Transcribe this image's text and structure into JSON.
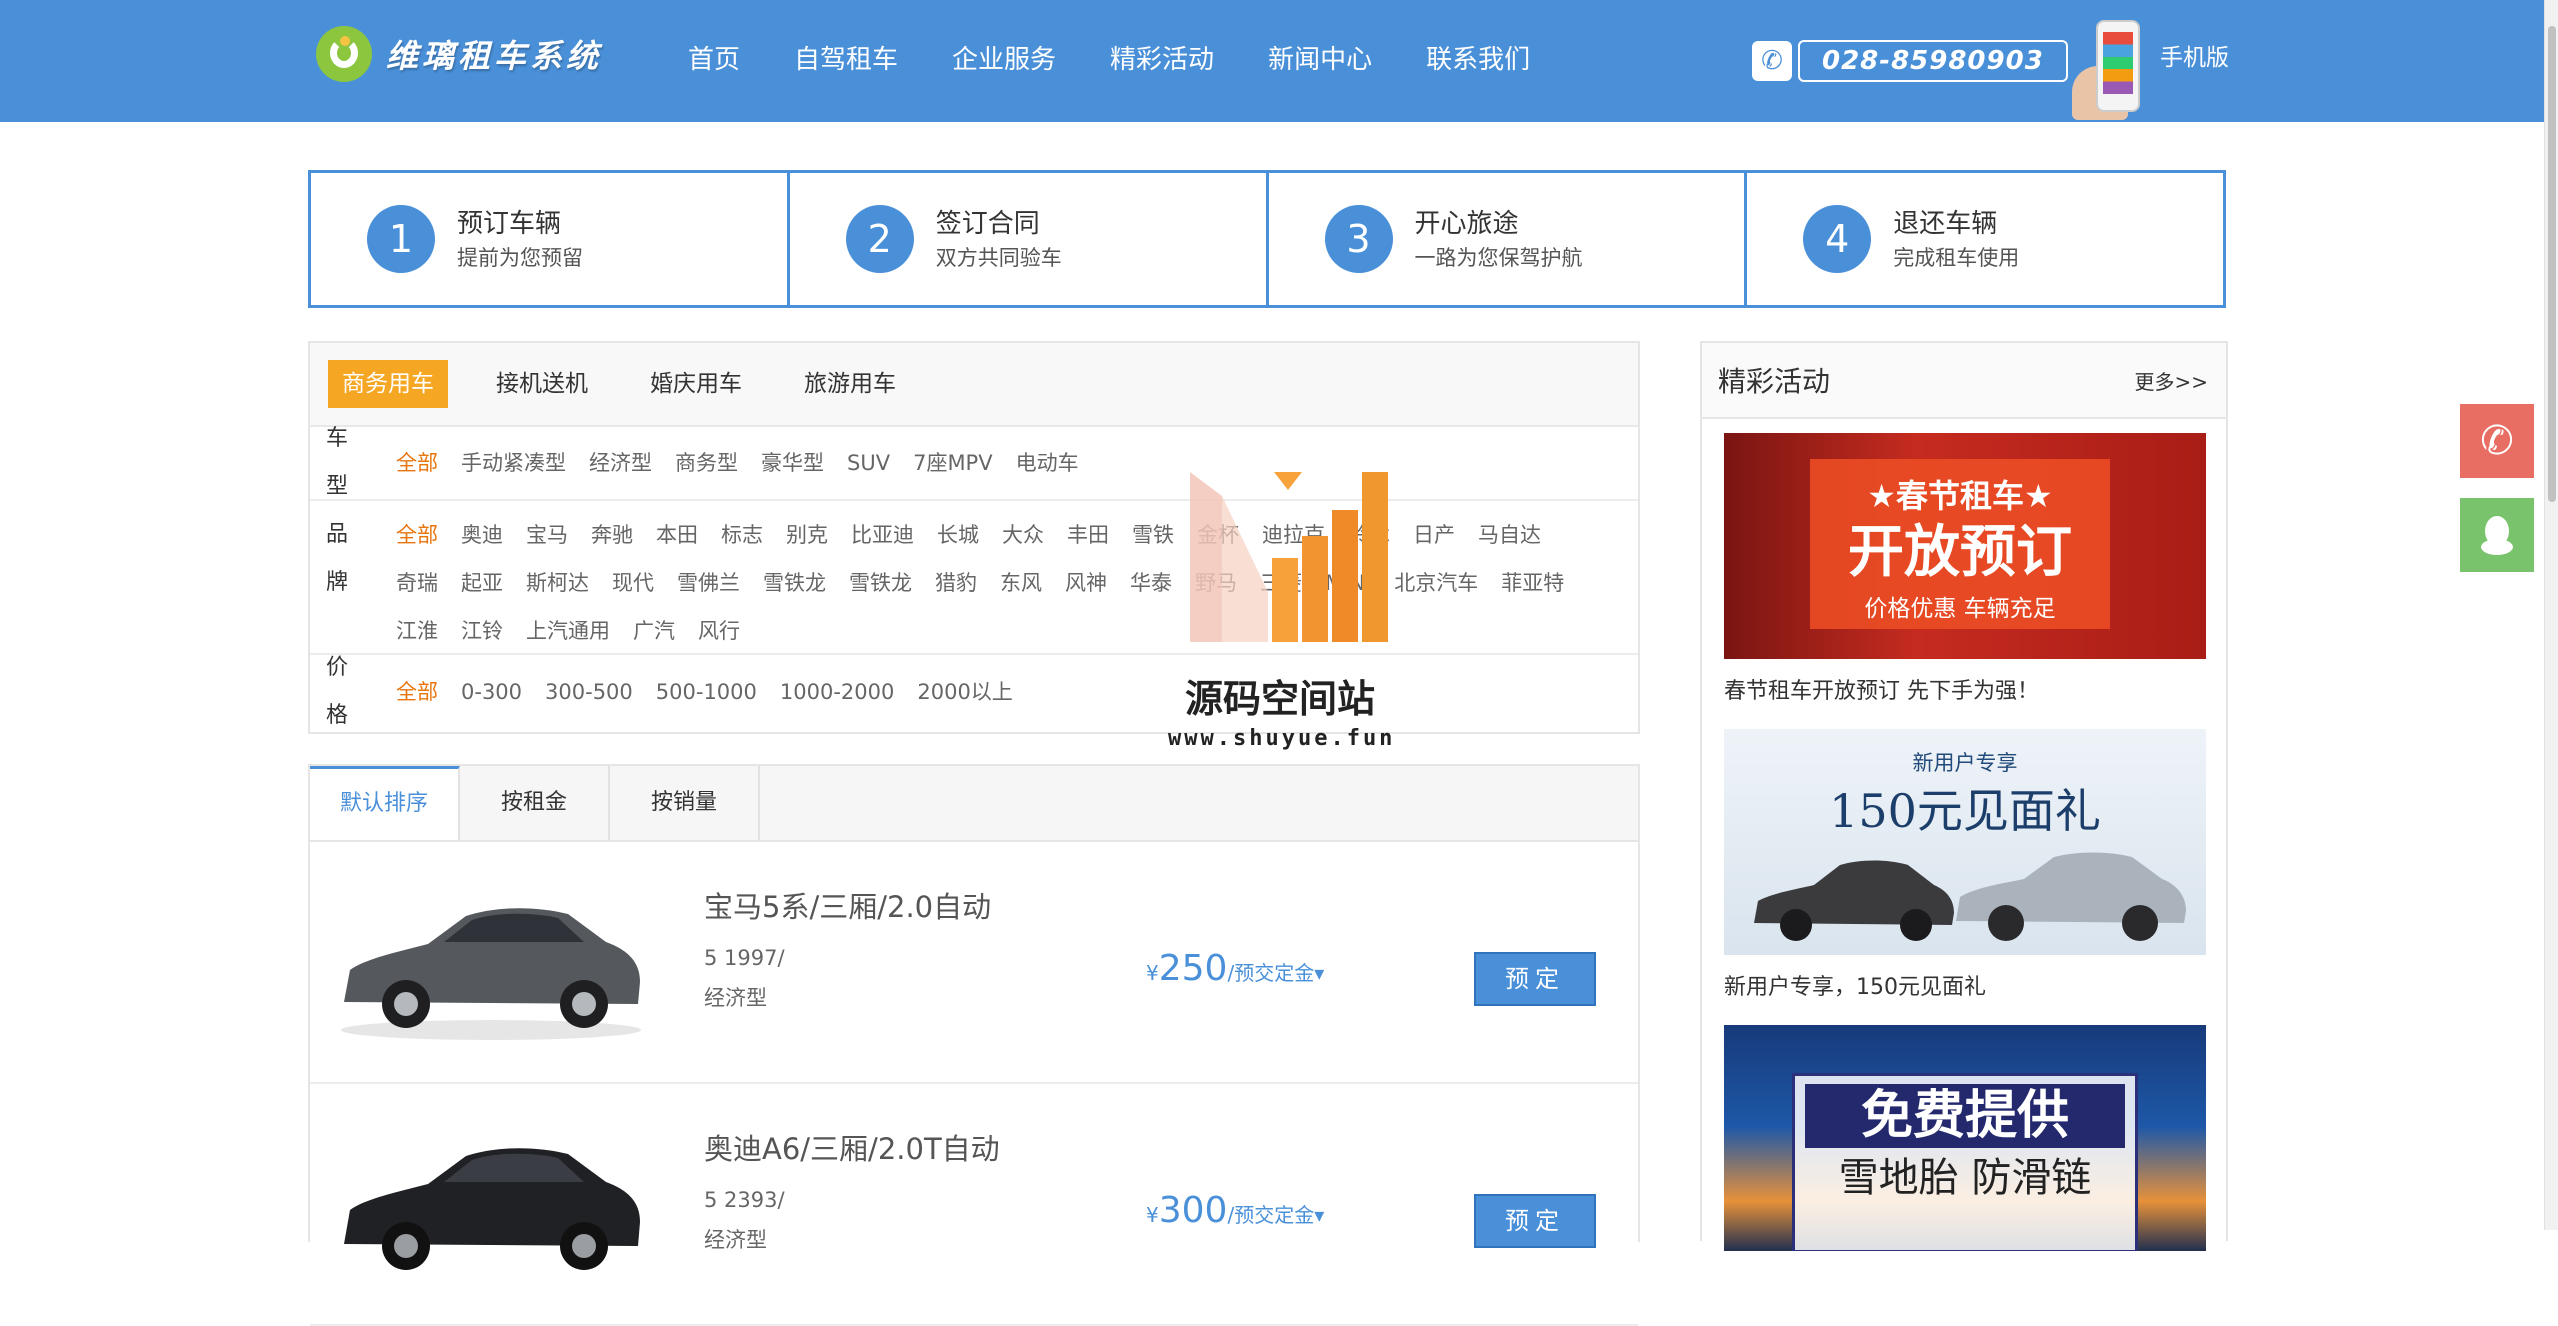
{
  "header": {
    "logo_text": "维璃租车系统",
    "nav": [
      "首页",
      "自驾租车",
      "企业服务",
      "精彩活动",
      "新闻中心",
      "联系我们"
    ],
    "phone": "028-85980903",
    "mobile_label": "手机版"
  },
  "steps": [
    {
      "num": "1",
      "title": "预订车辆",
      "sub": "提前为您预留"
    },
    {
      "num": "2",
      "title": "签订合同",
      "sub": "双方共同验车"
    },
    {
      "num": "3",
      "title": "开心旅途",
      "sub": "一路为您保驾护航"
    },
    {
      "num": "4",
      "title": "退还车辆",
      "sub": "完成租车使用"
    }
  ],
  "filter": {
    "tabs": [
      "商务用车",
      "接机送机",
      "婚庆用车",
      "旅游用车"
    ],
    "active_tab": "商务用车",
    "type": {
      "label": "车 型",
      "options": [
        "全部",
        "手动紧凑型",
        "经济型",
        "商务型",
        "豪华型",
        "SUV",
        "7座MPV",
        "电动车"
      ]
    },
    "brand": {
      "label": "品 牌",
      "options": [
        "全部",
        "奥迪",
        "宝马",
        "奔驰",
        "本田",
        "标志",
        "别克",
        "比亚迪",
        "长城",
        "大众",
        "丰田",
        "雪铁",
        "金杯",
        "迪拉克",
        "铃木",
        "日产",
        "马自达",
        "奇瑞",
        "起亚",
        "斯柯达",
        "现代",
        "雪佛兰",
        "雪铁龙",
        "雪铁龙",
        "猎豹",
        "东风",
        "风神",
        "华泰",
        "野马",
        "三菱",
        "MINI",
        "北京汽车",
        "菲亚特",
        "江淮",
        "江铃",
        "上汽通用",
        "广汽",
        "风行"
      ]
    },
    "price": {
      "label": "价 格",
      "options": [
        "全部",
        "0-300",
        "300-500",
        "500-1000",
        "1000-2000",
        "2000以上"
      ]
    }
  },
  "watermark": {
    "title": "源码空间站",
    "url": "www.shuyue.fun"
  },
  "sort": [
    "默认排序",
    "按租金",
    "按销量"
  ],
  "cars": [
    {
      "name": "宝马5系/三厢/2.0自动",
      "spec1": "5 1997/",
      "spec2": "经济型",
      "currency": "¥",
      "price": "250",
      "unit": "/预交定金▾",
      "button": "预定",
      "color": "#55585d"
    },
    {
      "name": "奥迪A6/三厢/2.0T自动",
      "spec1": "5 2393/",
      "spec2": "经济型",
      "currency": "¥",
      "price": "300",
      "unit": "/预交定金▾",
      "button": "预定",
      "color": "#202124"
    }
  ],
  "side": {
    "title": "精彩活动",
    "more": "更多>>",
    "promos": [
      {
        "caption": "春节租车开放预订 先下手为强！",
        "l1": "★春节租车★",
        "l2": "开放预订",
        "l3": "价格优惠 车辆充足"
      },
      {
        "caption": "新用户专享，150元见面礼",
        "l1": "新用户专享",
        "l2": "150元见面礼"
      },
      {
        "caption": "",
        "l1": "免费提供",
        "l2": "雪地胎 防滑链"
      }
    ]
  },
  "colors": {
    "primary": "#4a90d9",
    "accent": "#f5a623",
    "selected": "#e8740c",
    "phone_float": "#e86e63",
    "qq_float": "#79c36d"
  },
  "icons": {
    "phone": "phone-icon",
    "qq": "qq-icon"
  }
}
